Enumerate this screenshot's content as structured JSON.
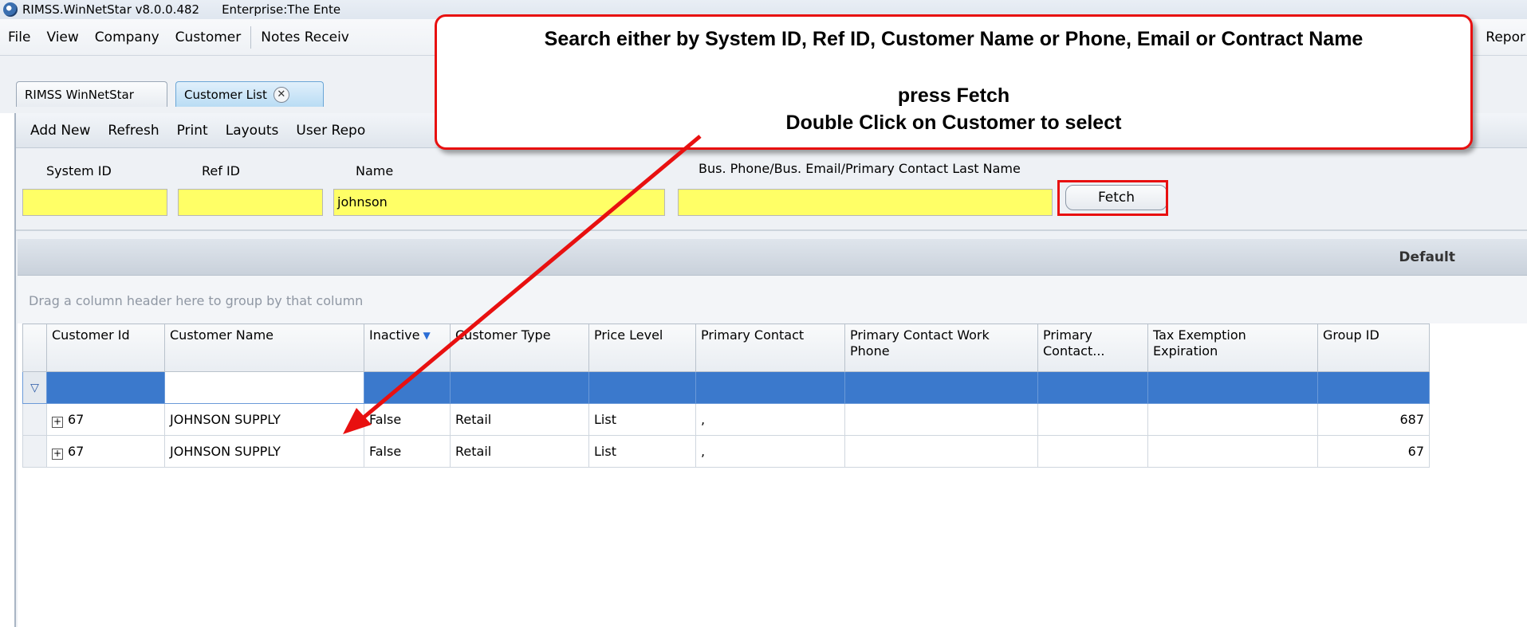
{
  "window": {
    "title": "RIMSS.WinNetStar v8.0.0.482",
    "enterprise": "Enterprise:The Ente"
  },
  "menu": {
    "items": [
      "File",
      "View",
      "Company",
      "Customer",
      "Notes Receiv"
    ],
    "right_item": "Repor"
  },
  "tabs": [
    {
      "label": "RIMSS WinNetStar",
      "active": false
    },
    {
      "label": "Customer List",
      "active": true,
      "close": "✕"
    }
  ],
  "toolbar": {
    "items": [
      "Add New",
      "Refresh",
      "Print",
      "Layouts",
      "User Repo"
    ]
  },
  "filters": {
    "system_id_label": "System ID",
    "system_id_value": "",
    "ref_id_label": "Ref ID",
    "ref_id_value": "",
    "name_label": "Name",
    "name_value": "johnson",
    "phone_label": "Bus. Phone/Bus. Email/Primary Contact Last Name",
    "phone_value": "",
    "fetch_label": "Fetch"
  },
  "grid": {
    "layout_label": "Default",
    "group_hint": "Drag a column header here to group by that column",
    "columns": [
      "Customer Id",
      "Customer Name",
      "Inactive",
      "Customer Type",
      "Price Level",
      "Primary Contact",
      "Primary Contact Work Phone",
      "Primary Contact...",
      "Tax Exemption Expiration",
      "Group ID"
    ],
    "rows": [
      {
        "customer_id": "67",
        "customer_name": "JOHNSON SUPPLY",
        "inactive": "False",
        "customer_type": "Retail",
        "price_level": "List",
        "primary_contact": ",",
        "work_phone": "",
        "contact_other": "",
        "tax_exemption": "",
        "group_id": "687"
      },
      {
        "customer_id": "67",
        "customer_name": "JOHNSON SUPPLY",
        "inactive": "False",
        "customer_type": "Retail",
        "price_level": "List",
        "primary_contact": ",",
        "work_phone": "",
        "contact_other": "",
        "tax_exemption": "",
        "group_id": "67"
      }
    ]
  },
  "callout": {
    "line1": "Search either by System ID, Ref ID, Customer Name or Phone, Email or Contract Name",
    "line2": "press Fetch",
    "line3": "Double Click on Customer to select"
  },
  "colors": {
    "annotation_red": "#e81010",
    "filter_yellow": "#ffff66",
    "selection_blue": "#3b79cc"
  }
}
